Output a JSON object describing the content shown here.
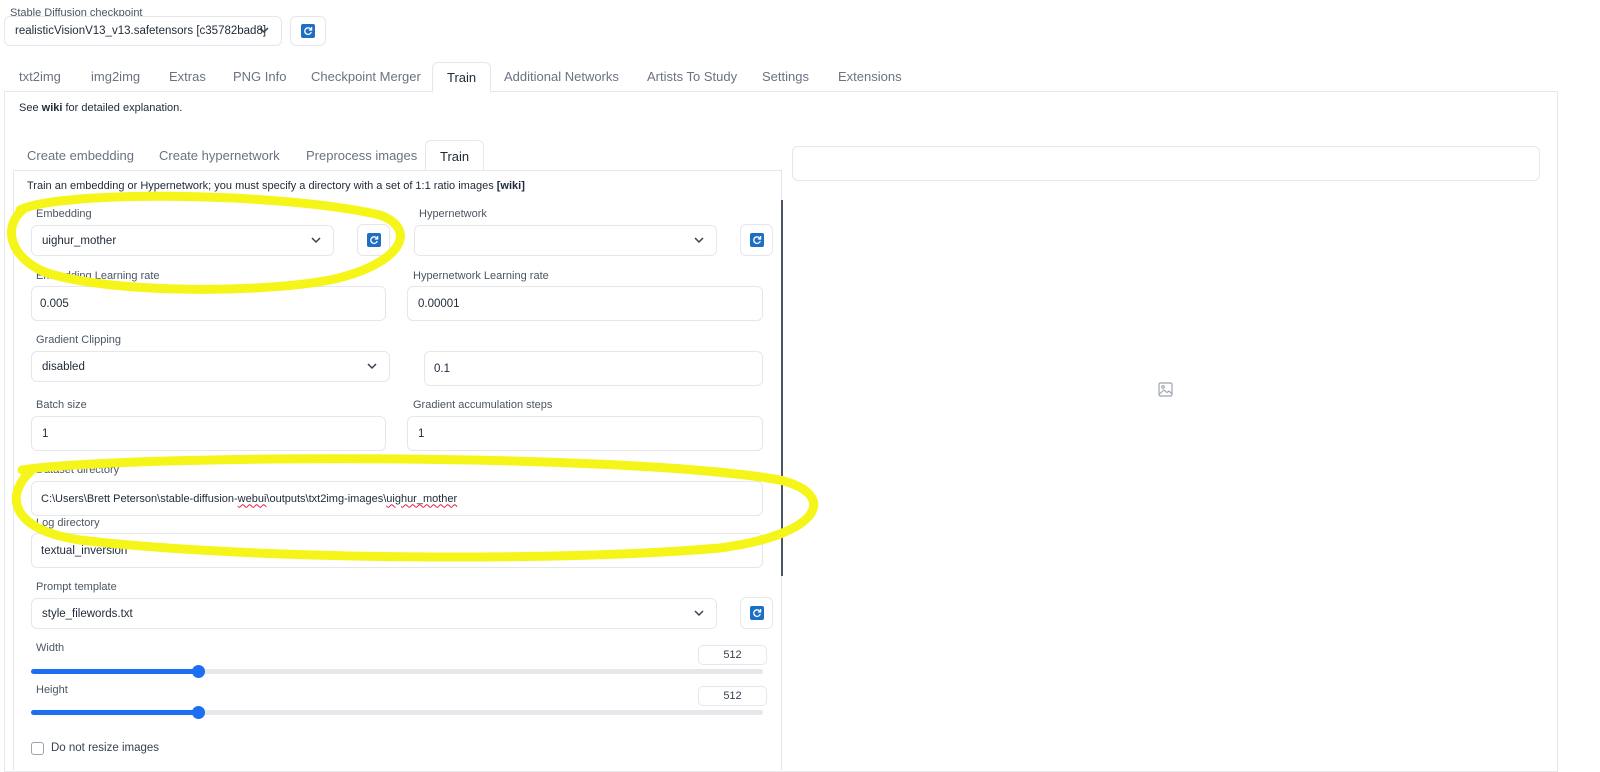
{
  "checkpoint": {
    "label": "Stable Diffusion checkpoint",
    "value": "realisticVisionV13_v13.safetensors [c35782bad8]",
    "refresh_icon": "refresh-icon"
  },
  "main_tabs": [
    "txt2img",
    "img2img",
    "Extras",
    "PNG Info",
    "Checkpoint Merger",
    "Train",
    "Additional Networks",
    "Artists To Study",
    "Settings",
    "Extensions"
  ],
  "active_main_tab": "Train",
  "intro": {
    "prefix": "See ",
    "link": "wiki",
    "suffix": " for detailed explanation."
  },
  "sub_tabs": [
    "Create embedding",
    "Create hypernetwork",
    "Preprocess images",
    "Train"
  ],
  "active_sub_tab": "Train",
  "train": {
    "description": "Train an embedding or Hypernetwork; you must specify a directory with a set of 1:1 ratio images",
    "description_link": "[wiki]",
    "embedding": {
      "label": "Embedding",
      "value": "uighur_mother"
    },
    "hypernetwork": {
      "label": "Hypernetwork",
      "value": ""
    },
    "embedding_lr": {
      "label": "Embedding Learning rate",
      "value": "0.005"
    },
    "hypernetwork_lr": {
      "label": "Hypernetwork Learning rate",
      "value": "0.00001"
    },
    "gradient_clipping": {
      "label": "Gradient Clipping",
      "value": "disabled",
      "amount": "0.1"
    },
    "batch_size": {
      "label": "Batch size",
      "value": "1"
    },
    "grad_accum": {
      "label": "Gradient accumulation steps",
      "value": "1"
    },
    "dataset_dir": {
      "label": "Dataset directory",
      "part1": "C:\\Users\\Brett Peterson\\stable-diffusion-",
      "part2": "webui",
      "part3": "\\outputs\\txt2img-images\\",
      "part4": "uighur_mother"
    },
    "log_dir": {
      "label": "Log directory",
      "value": "textual_inversion"
    },
    "prompt_template": {
      "label": "Prompt template",
      "value": "style_filewords.txt"
    },
    "width": {
      "label": "Width",
      "value": "512",
      "fraction": 0.228
    },
    "height": {
      "label": "Height",
      "value": "512",
      "fraction": 0.228
    },
    "no_resize": {
      "label": "Do not resize images",
      "checked": false
    }
  },
  "colors": {
    "accent": "#1d6ff2",
    "highlight": "#f5f51a",
    "refresh_icon": "#1d6fc4"
  },
  "output_panel": {
    "image_icon": "image-icon"
  }
}
